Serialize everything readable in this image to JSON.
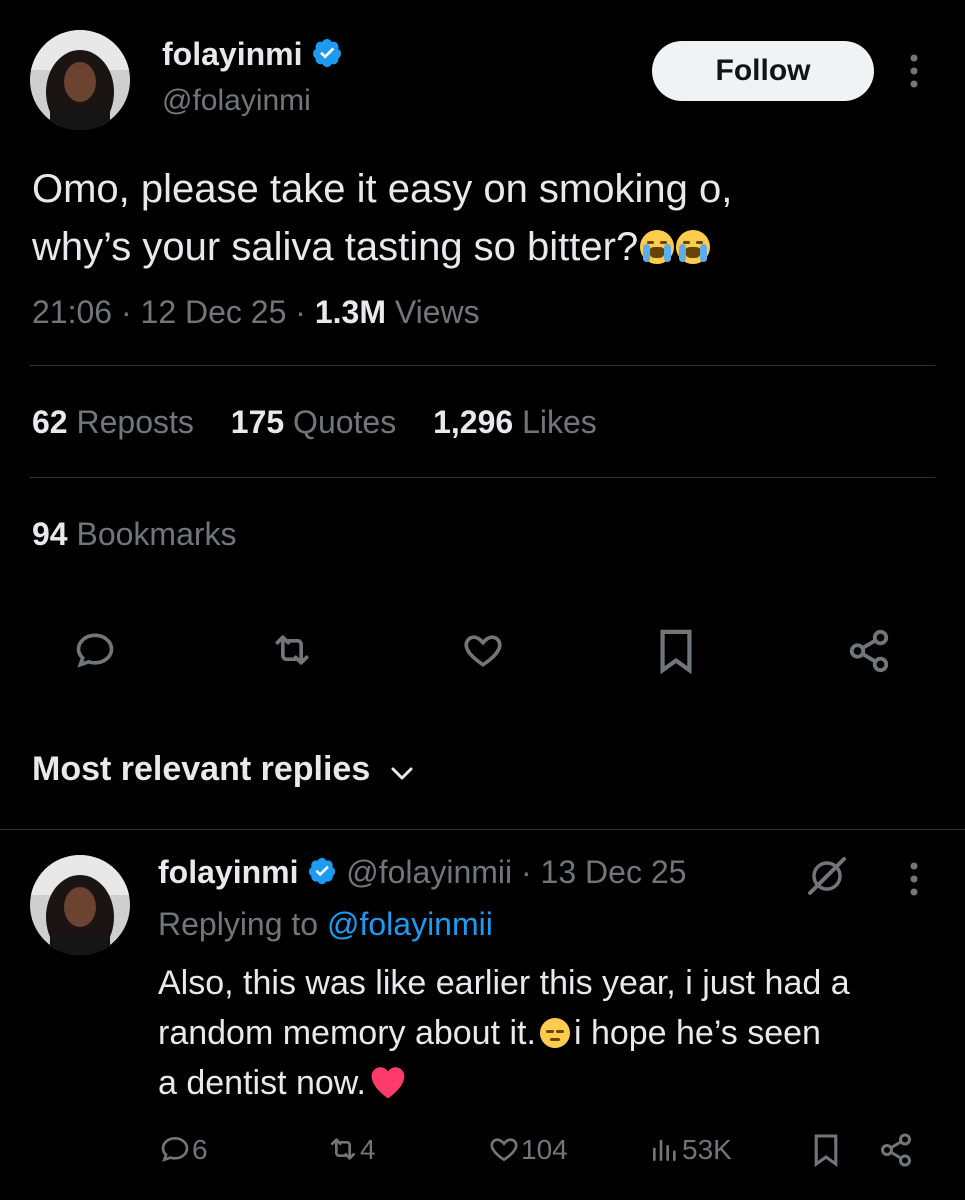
{
  "tweet": {
    "author_name": "folayinmi",
    "author_handle": "@folayinmi",
    "follow_label": "Follow",
    "text_line1": "Omo, please take it easy on smoking o,",
    "text_line2": "why’s your saliva tasting so bitter?",
    "text_emojis": [
      "loudly-crying-face",
      "loudly-crying-face"
    ],
    "time": "21:06",
    "date": "12 Dec 25",
    "views_count": "1.3M",
    "views_label": "Views",
    "reposts_count": "62",
    "reposts_label": "Reposts",
    "quotes_count": "175",
    "quotes_label": "Quotes",
    "likes_count": "1,296",
    "likes_label": "Likes",
    "bookmarks_count": "94",
    "bookmarks_label": "Bookmarks",
    "actions": [
      "reply-icon",
      "repost-icon",
      "like-icon",
      "bookmark-icon",
      "share-icon"
    ]
  },
  "replies_sort": {
    "label": "Most relevant replies"
  },
  "reply": {
    "author_name": "folayinmi",
    "author_handle": "@folayinmii",
    "date": "13 Dec 25",
    "replying_prefix": "Replying to",
    "replying_handle": "@folayinmii",
    "text_line1": "Also, this was like earlier this year, i just had a",
    "text_line2a": "random memory about it.",
    "text_line2b": "i hope he’s seen",
    "text_line3": "a dentist now.",
    "text_emojis": [
      "pensive-face",
      "red-heart"
    ],
    "reply_count": "6",
    "repost_count": "4",
    "like_count": "104",
    "view_count": "53K"
  },
  "colors": {
    "background": "#000000",
    "text": "#e7e9ea",
    "muted": "#71767b",
    "link": "#1d9bf0",
    "verified": "#1d9bf0",
    "divider": "#2f3336"
  }
}
